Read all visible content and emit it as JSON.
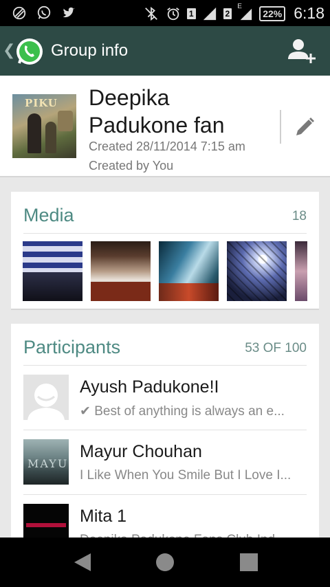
{
  "status_bar": {
    "sim1": "1",
    "sim2": "2",
    "network_type": "E",
    "battery": "22%",
    "time": "6:18"
  },
  "action_bar": {
    "title": "Group info"
  },
  "group": {
    "name": "Deepika Padukone fan",
    "avatar_text": "PIKU",
    "created": "Created 28/11/2014 7:15 am",
    "created_by": "Created by You"
  },
  "media": {
    "title": "Media",
    "count": "18"
  },
  "participants": {
    "title": "Participants",
    "count": "53 OF 100",
    "items": [
      {
        "name": "Ayush Padukone!I",
        "status": "✔ Best of anything is always an e..."
      },
      {
        "name": "Mayur Chouhan",
        "status": "I Like When You Smile But I Love I..."
      },
      {
        "name": "Mita 1",
        "status": "Deepika Padukone Fans Club Ind..."
      }
    ],
    "mayur_avatar_text": "MAYU"
  }
}
